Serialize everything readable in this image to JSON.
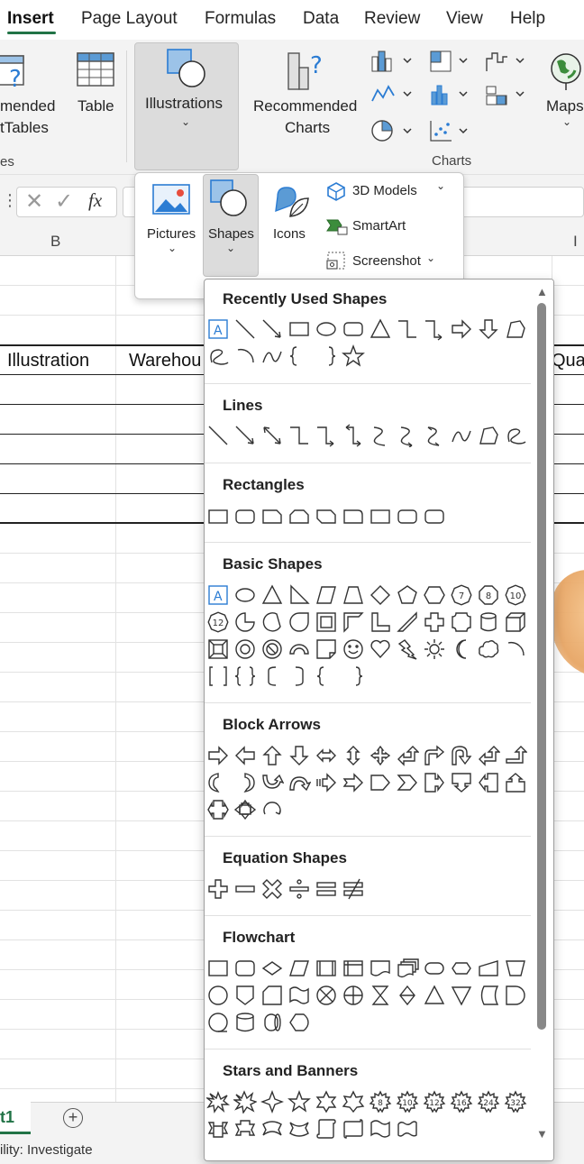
{
  "tabs": [
    "Insert",
    "Page Layout",
    "Formulas",
    "Data",
    "Review",
    "View",
    "Help"
  ],
  "ribbon": {
    "pivot_label_1": "mended",
    "pivot_label_2": "tTables",
    "table_label": "Table",
    "illustrations_label": "Illustrations",
    "recommended_label_1": "Recommended",
    "recommended_label_2": "Charts",
    "maps_label": "Maps",
    "group_tables": "es",
    "group_charts": "Charts"
  },
  "formula_bar": {
    "fx": "fx"
  },
  "illustrations_menu": {
    "pictures": "Pictures",
    "shapes": "Shapes",
    "icons": "Icons",
    "models": "3D Models",
    "smartart": "SmartArt",
    "screenshot": "Screenshot"
  },
  "sheet": {
    "columns": [
      "B",
      "I"
    ],
    "headers": {
      "c1": "Illustration",
      "c2": "Warehou",
      "c3": "Qua"
    },
    "tab_name": "t1"
  },
  "status": "ility: Investigate",
  "gallery": {
    "categories": [
      "Recently Used Shapes",
      "Lines",
      "Rectangles",
      "Basic Shapes",
      "Block Arrows",
      "Equation Shapes",
      "Flowchart",
      "Stars and Banners"
    ],
    "counts": {
      "oct7": "7",
      "oct8": "8",
      "dec10": "10",
      "dodec12": "12",
      "star8": "8",
      "star10": "10",
      "star12": "12",
      "star16": "16",
      "star24": "24",
      "star32": "32"
    }
  },
  "colors": {
    "accent": "#217346",
    "selected_shape": "#2b7cd3"
  }
}
